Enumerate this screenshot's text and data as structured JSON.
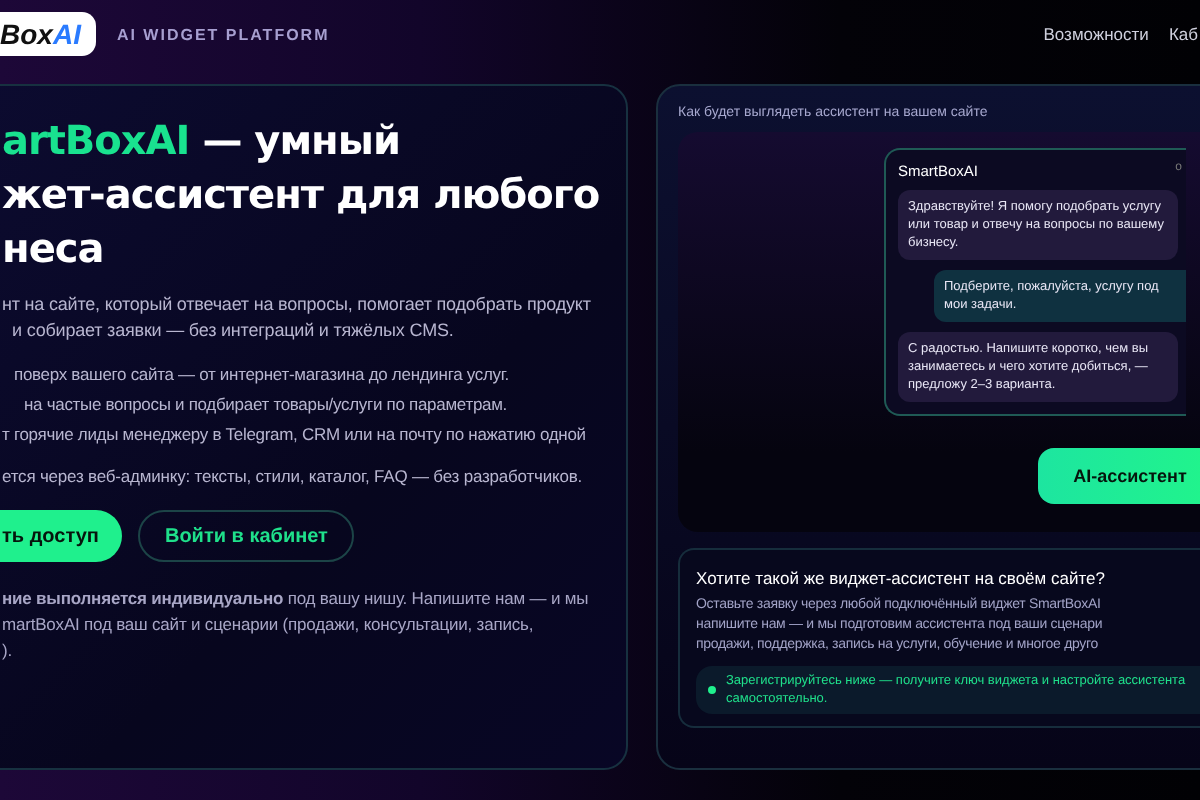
{
  "header": {
    "logo": {
      "dark": "Box",
      "accent": "AI"
    },
    "tagline": "AI WIDGET PLATFORM",
    "nav": [
      "Возможности",
      "Каб"
    ]
  },
  "hero": {
    "heading": {
      "accent": "artBoxAI",
      "line_1": "— умный",
      "line_2": "жет-ассистент для любого",
      "line_3": "неса"
    },
    "intro": [
      "нт на сайте, который отвечает на вопросы, помогает подобрать продукт",
      "и собирает заявки — без интеграций и тяжёлых CMS."
    ],
    "features": [
      "поверх вашего сайта — от интернет-магазина до лендинга услуг.",
      "на частые вопросы и подбирает товары/услуги по параметрам.",
      "т горячие лиды менеджеру в Telegram, CRM или на почту по нажатию одной"
    ],
    "admin_note": "ется через веб-админку: тексты, стили, каталог, FAQ — без разработчиков.",
    "buttons": [
      {
        "label": "ть доступ",
        "kind": "primary"
      },
      {
        "label": "Войти в кабинет",
        "kind": "outline"
      }
    ],
    "note": [
      "**ние выполняется индивидуально** под вашу нишу. Напишите нам — и мы",
      "martBoxAI под ваш сайт и сценарии (продажи, консультации, запись,",
      ")."
    ]
  },
  "preview": {
    "caption": "Как будет выглядеть ассистент на вашем сайте",
    "chat": {
      "title": "SmartBoxAI",
      "status": "о",
      "messages": [
        {
          "kind": "bot",
          "text": "Здравствуйте! Я помогу подобрать услугу или товар и отвечу на вопросы по вашему бизнесу."
        },
        {
          "kind": "user",
          "text": "Подберите, пожалуйста, услугу под мои задачи."
        },
        {
          "kind": "bot",
          "text": "С радостью. Напишите коротко, чем вы занимаетесь и чего хотите добиться, — предложу 2–3 варианта."
        }
      ]
    },
    "launcher": "AI-ассистент"
  },
  "cta": {
    "title": "Хотите такой же виджет-ассистент на своём сайте?",
    "lines": [
      "Оставьте заявку через любой подключённый виджет SmartBoxAI",
      "напишите нам — и мы подготовим ассистента под ваши сценари",
      "продажи, поддержка, запись на услуги, обучение и многое друго"
    ],
    "tip": "Зарегистрируйтесь ниже — получите ключ виджета и настройте ассистента самостоятельно."
  }
}
